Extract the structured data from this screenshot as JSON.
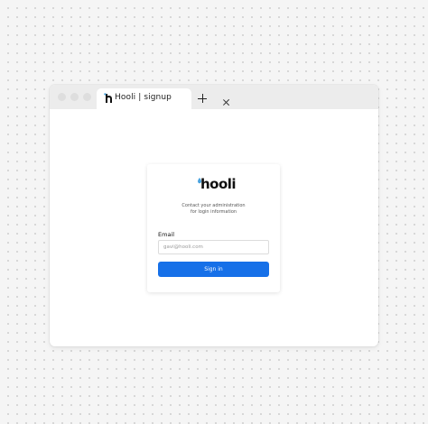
{
  "browser": {
    "tab": {
      "title": "Hooli | signup",
      "icon": "hooli-favicon-icon"
    },
    "controls": {
      "close_icon": "close-icon",
      "new_tab_icon": "plus-icon"
    }
  },
  "login": {
    "logo_text": "hooli",
    "subtitle_line1": "Contact your administration",
    "subtitle_line2": "for login information",
    "email_label": "Email",
    "email_placeholder": "gavi@hooli.com",
    "email_value": "",
    "signin_label": "Sign in"
  },
  "colors": {
    "accent": "#1670e8",
    "logo_drop": "#4aa3df"
  }
}
